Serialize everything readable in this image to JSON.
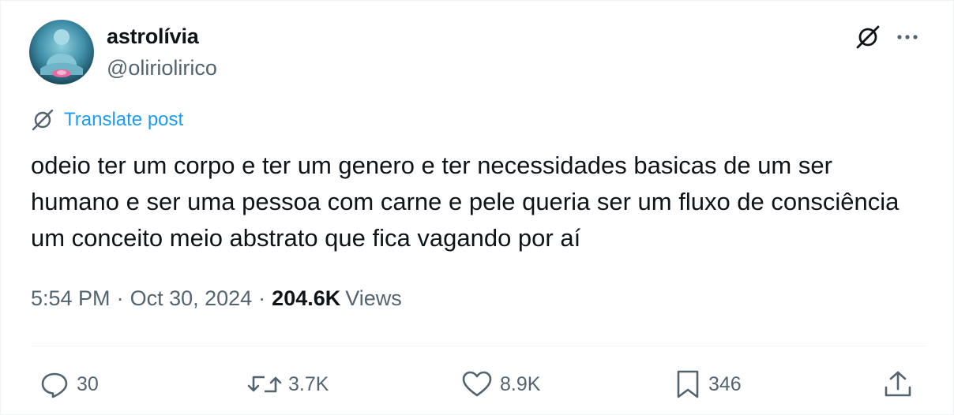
{
  "author": {
    "display_name": "astrolívia",
    "handle": "@oliriolirico"
  },
  "translate_label": "Translate post",
  "tweet_text": "odeio ter um corpo e ter um genero e ter necessidades basicas de um ser humano e ser uma pessoa com carne e pele queria ser um fluxo de consciência um conceito meio abstrato que fica vagando por aí",
  "meta": {
    "time": "5:54 PM",
    "date": "Oct 30, 2024",
    "separator": "·",
    "views_count": "204.6K",
    "views_label": "Views"
  },
  "actions": {
    "replies": "30",
    "reposts": "3.7K",
    "likes": "8.9K",
    "bookmarks": "346"
  },
  "colors": {
    "text": "#0f1419",
    "secondary": "#536471",
    "link": "#1d9bf0",
    "divider": "#eff3f4"
  },
  "icons": [
    "grok-icon",
    "more-icon",
    "reply-icon",
    "repost-icon",
    "like-icon",
    "bookmark-icon",
    "share-icon"
  ]
}
